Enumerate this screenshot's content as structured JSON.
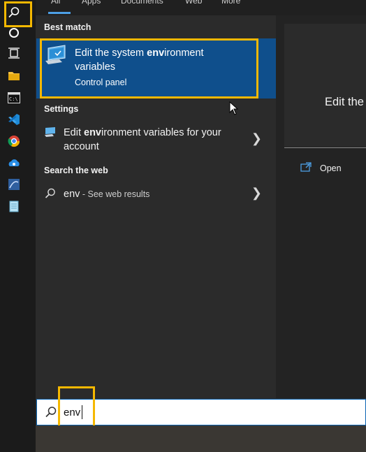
{
  "taskbar": {
    "icons": [
      "search-icon",
      "cortana-icon",
      "task-view-icon",
      "file-explorer-icon",
      "terminal-icon",
      "vscode-icon",
      "chrome-icon",
      "cloud-app-icon",
      "network-app-icon",
      "notepad-icon"
    ]
  },
  "tabs": [
    "All",
    "Apps",
    "Documents",
    "Web",
    "More"
  ],
  "sections": {
    "best_match": "Best match",
    "settings": "Settings",
    "search_web": "Search the web"
  },
  "best_match": {
    "title_pre": "Edit the system ",
    "title_bold": "env",
    "title_post": "ironment variables",
    "subtitle": "Control panel"
  },
  "settings_item": {
    "pre": "Edit ",
    "bold": "env",
    "post": "ironment variables for your account"
  },
  "web_item": {
    "query": "env",
    "suffix": " - See web results"
  },
  "preview": {
    "title": "Edit the",
    "open_label": "Open"
  },
  "search": {
    "value": "env"
  },
  "colors": {
    "accent": "#0f4f8c",
    "highlight": "#f5b800"
  }
}
